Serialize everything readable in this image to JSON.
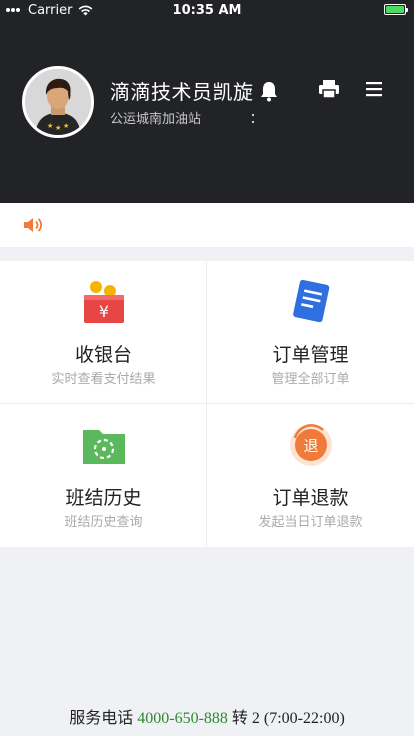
{
  "status_bar": {
    "carrier": "Carrier",
    "time": "10:35 AM"
  },
  "header": {
    "title": "滴滴技术员凯旋",
    "subtitle": "公运城南加油站",
    "bg_color": "#222326"
  },
  "notice": {
    "text": ""
  },
  "menu": [
    {
      "label": "收银台",
      "sub": "实时查看支付结果",
      "icon": "cashier-icon"
    },
    {
      "label": "订单管理",
      "sub": "管理全部订单",
      "icon": "document-icon"
    },
    {
      "label": "班结历史",
      "sub": "班结历史查询",
      "icon": "shift-history-icon"
    },
    {
      "label": "订单退款",
      "sub": "发起当日订单退款",
      "icon": "refund-icon"
    }
  ],
  "icons": {
    "refund_glyph": "退",
    "cashier_glyph": "¥"
  },
  "footer": {
    "prefix": "服务电话",
    "phone": "4000-650-888",
    "suffix": "转 2 (7:00-22:00)",
    "phone_color": "#2e8b2e"
  },
  "colors": {
    "accent_orange": "#f07a3a",
    "icon_blue": "#2f6fe0",
    "icon_green": "#5cb85c",
    "icon_red": "#e84545"
  }
}
